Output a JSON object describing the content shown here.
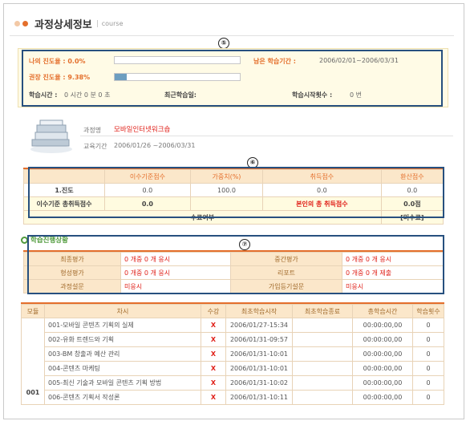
{
  "header": {
    "title": "과정상세정보",
    "subtitle": "course"
  },
  "markers": {
    "m5": "⑤",
    "m6": "⑥",
    "m7": "⑦"
  },
  "progress": {
    "my_label": "나의 진도율 : 0.0%",
    "my_fraction": 0.0,
    "rec_label": "권장 진도율 : 9.38%",
    "rec_fraction": 0.0938,
    "remaining_label": "남은 학습기간 :",
    "remaining_value": "2006/02/01~2006/03/31",
    "study_time_label": "학습시간 :",
    "study_time_value": "0 시간 0 분 0 초",
    "recent_label": "최근학습일:",
    "start_count_label": "학습시작횟수 :",
    "start_count_value": "0 번"
  },
  "course": {
    "name_label": "과정명",
    "name_value": "모바일인터넷워크숍",
    "period_label": "교육기간",
    "period_value": "2006/01/26 ~2006/03/31"
  },
  "score_table": {
    "headers": [
      "이수기준점수",
      "가중치(%)",
      "취득점수",
      "환산점수"
    ],
    "row1": {
      "label": "1.진도",
      "values": [
        "0.0",
        "100.0",
        "0.0",
        "0.0"
      ]
    },
    "row2": {
      "label": "이수기준 총취득점수",
      "value": "0.0",
      "label2": "본인의 총 취득점수",
      "value2": "0.0점"
    },
    "row3": {
      "label": "수료여부",
      "value": "[미수료]"
    }
  },
  "status": {
    "heading": "학습진행상황",
    "rows": [
      {
        "k1": "최종평가",
        "v1": "0 개중 0 개 응시",
        "k2": "중간평가",
        "v2": "0 개중 0 개 응시"
      },
      {
        "k1": "형성평가",
        "v1": "0 개중 0 개 응시",
        "k2": "리포트",
        "v2": "0 개중 0 개 제출"
      },
      {
        "k1": "과정설문",
        "v1": "미응시",
        "k2": "가입등기설문",
        "v2": "미응시"
      }
    ]
  },
  "lessons": {
    "headers": [
      "모듈",
      "차시",
      "수강",
      "최초학습시작",
      "최초학습종료",
      "총학습시간",
      "학습횟수"
    ],
    "module": "001",
    "rows": [
      {
        "title": "001-모바일 콘텐츠 기획의 실제",
        "mark": "X",
        "start": "2006/01/27-15:34",
        "end": "",
        "total": "00:00:00,00",
        "count": "0"
      },
      {
        "title": "002-유화 트렌드와 기획",
        "mark": "X",
        "start": "2006/01/31-09:57",
        "end": "",
        "total": "00:00:00,00",
        "count": "0"
      },
      {
        "title": "003-BM 창출과 예산 관리",
        "mark": "X",
        "start": "2006/01/31-10:01",
        "end": "",
        "total": "00:00:00,00",
        "count": "0"
      },
      {
        "title": "004-콘텐츠 마케팅",
        "mark": "X",
        "start": "2006/01/31-10:01",
        "end": "",
        "total": "00:00:00,00",
        "count": "0"
      },
      {
        "title": "005-최신 기술과 모바일 콘텐츠 기획 방법",
        "mark": "X",
        "start": "2006/01/31-10:02",
        "end": "",
        "total": "00:00:00,00",
        "count": "0"
      },
      {
        "title": "006-콘텐츠 기획서 작성론",
        "mark": "X",
        "start": "2006/01/31-10:11",
        "end": "",
        "total": "00:00:00,00",
        "count": "0"
      }
    ]
  }
}
